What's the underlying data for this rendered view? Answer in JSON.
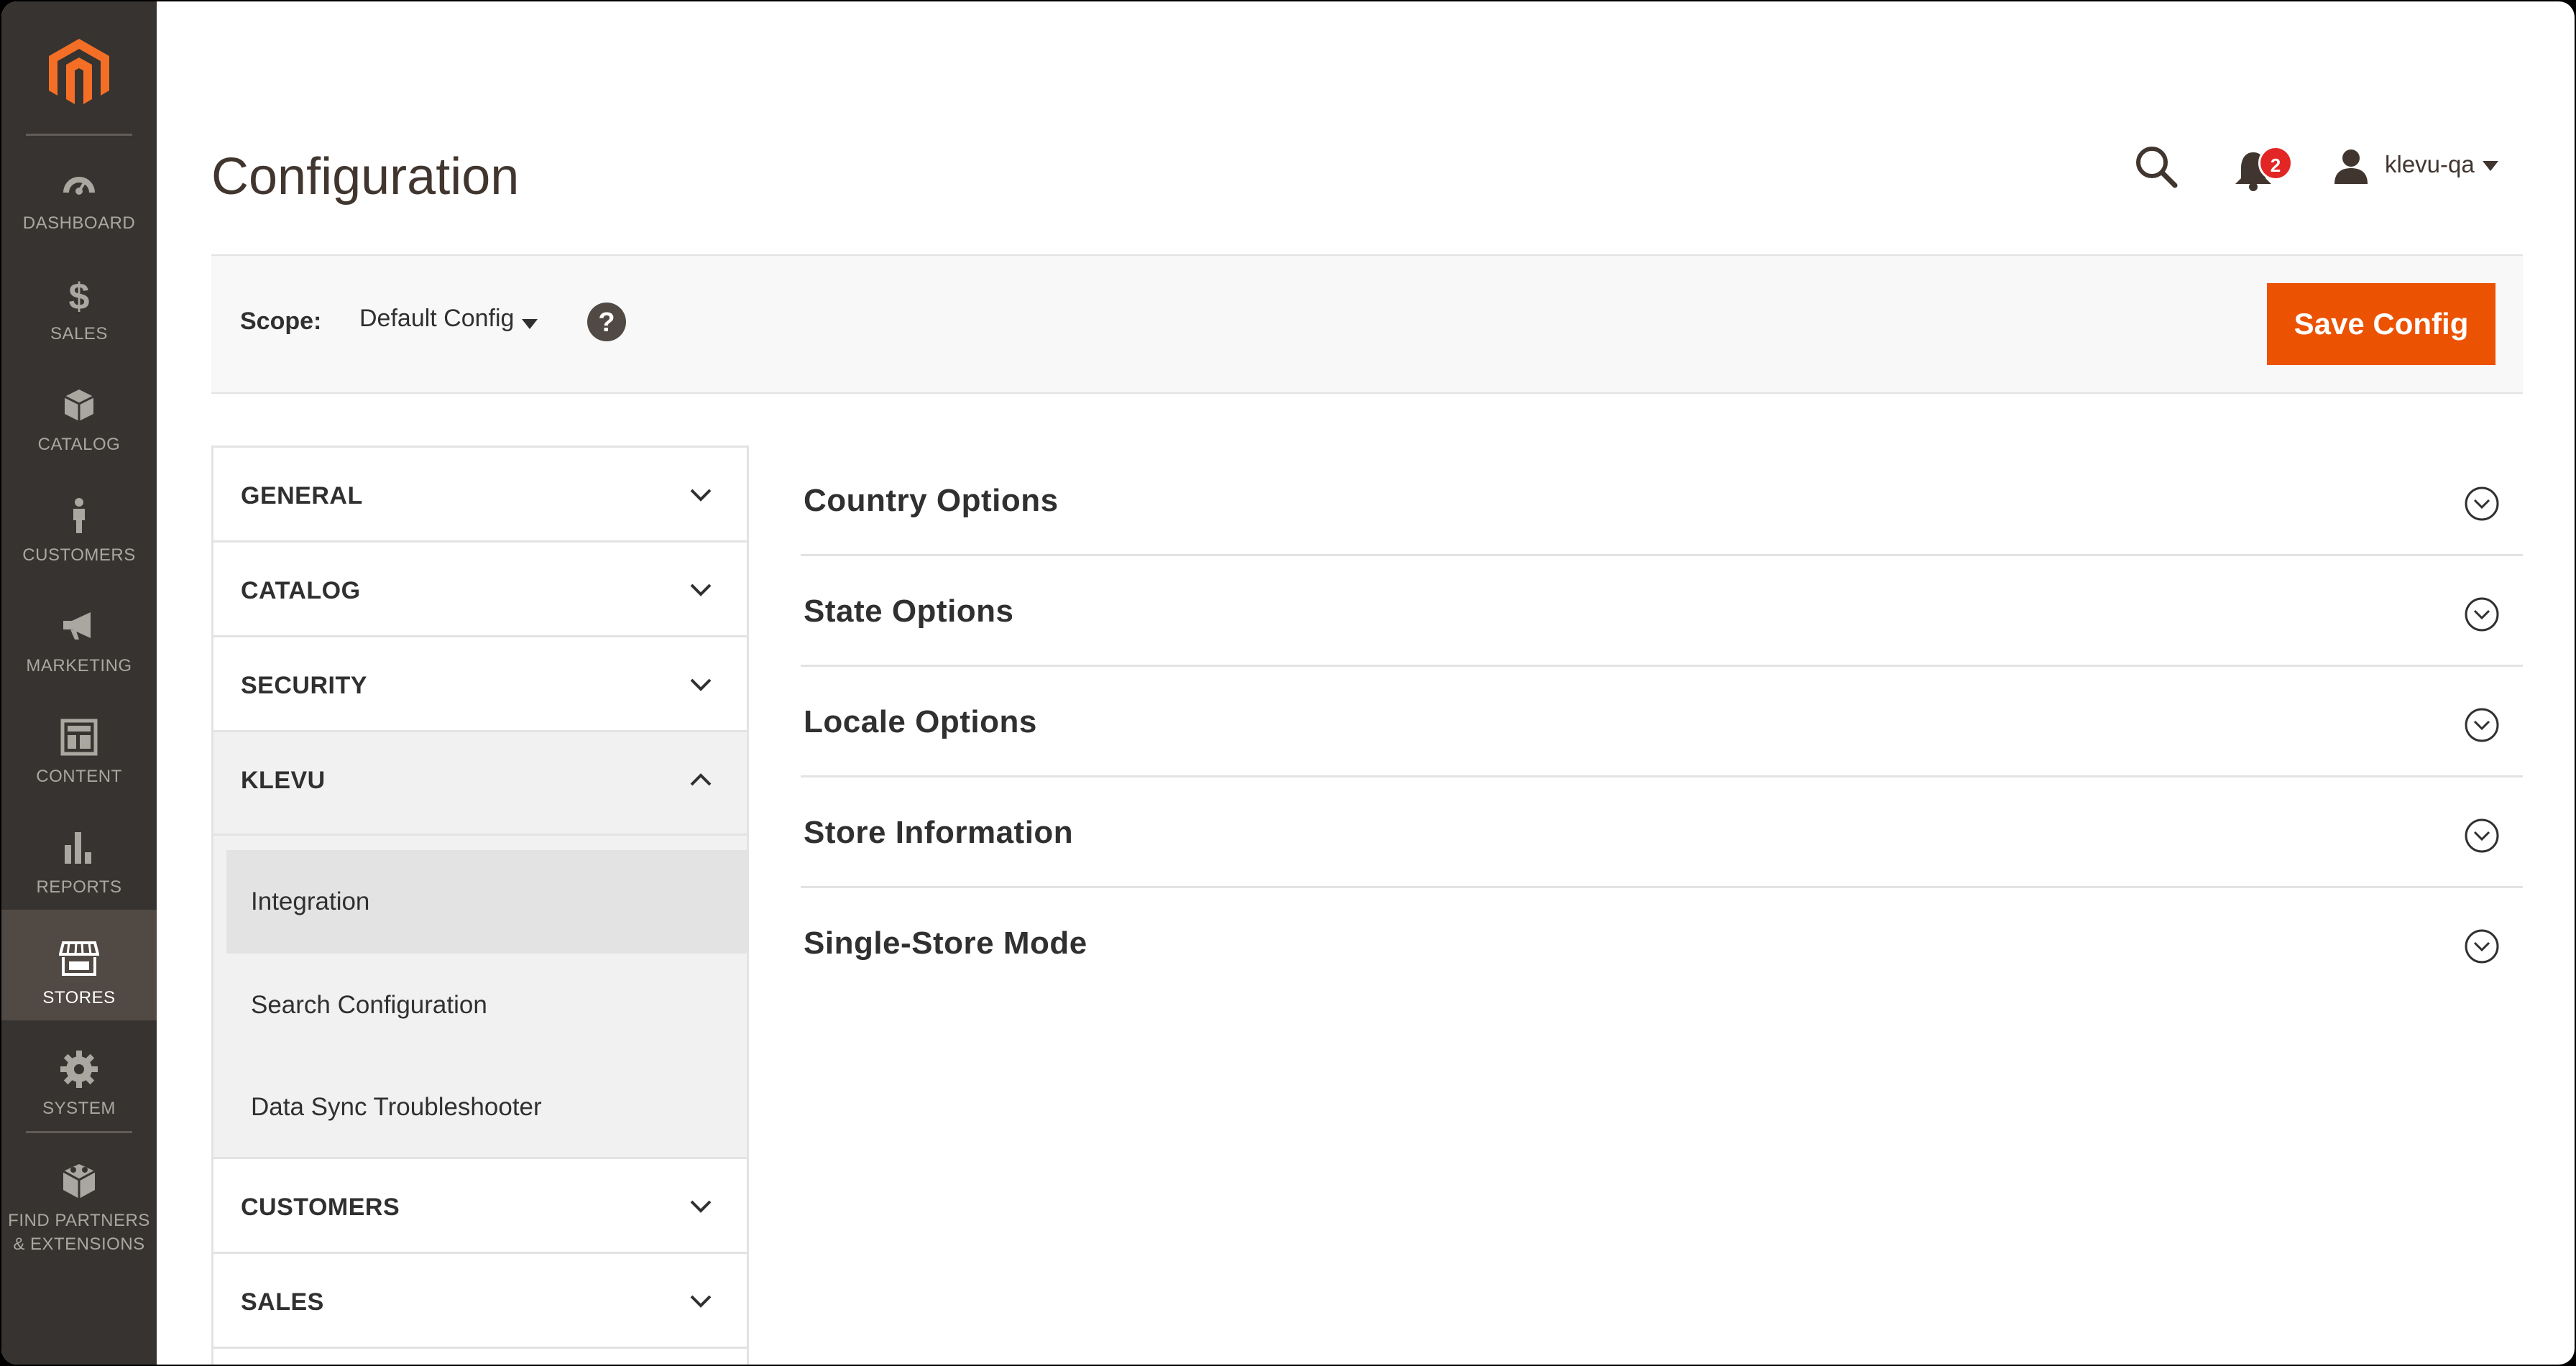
{
  "nav": {
    "items": [
      {
        "label": "DASHBOARD",
        "icon": "dashboard-icon",
        "active": false
      },
      {
        "label": "SALES",
        "icon": "dollar-icon",
        "active": false
      },
      {
        "label": "CATALOG",
        "icon": "box-icon",
        "active": false
      },
      {
        "label": "CUSTOMERS",
        "icon": "person-icon",
        "active": false
      },
      {
        "label": "MARKETING",
        "icon": "megaphone-icon",
        "active": false
      },
      {
        "label": "CONTENT",
        "icon": "layout-icon",
        "active": false
      },
      {
        "label": "REPORTS",
        "icon": "bar-chart-icon",
        "active": false
      },
      {
        "label": "STORES",
        "icon": "storefront-icon",
        "active": true
      },
      {
        "label": "SYSTEM",
        "icon": "gear-icon",
        "active": false
      },
      {
        "label": "FIND PARTNERS & EXTENSIONS",
        "icon": "extension-box-icon",
        "active": false
      }
    ]
  },
  "header": {
    "title": "Configuration",
    "notifications_count": "2",
    "user_name": "klevu-qa"
  },
  "scope": {
    "label": "Scope:",
    "selected": "Default Config",
    "save_label": "Save Config"
  },
  "tabs": [
    {
      "label": "GENERAL",
      "open": false
    },
    {
      "label": "CATALOG",
      "open": false
    },
    {
      "label": "SECURITY",
      "open": false
    },
    {
      "label": "KLEVU",
      "open": true
    },
    {
      "label": "CUSTOMERS",
      "open": false
    },
    {
      "label": "SALES",
      "open": false
    }
  ],
  "klevu_submenu": [
    {
      "label": "Integration",
      "active": true
    },
    {
      "label": "Search Configuration",
      "active": false
    },
    {
      "label": "Data Sync Troubleshooter",
      "active": false
    }
  ],
  "sections": [
    {
      "label": "Country Options"
    },
    {
      "label": "State Options"
    },
    {
      "label": "Locale Options"
    },
    {
      "label": "Store Information"
    },
    {
      "label": "Single-Store Mode"
    }
  ],
  "colors": {
    "nav_bg": "#373330",
    "nav_active_bg": "#514943",
    "accent": "#eb5202",
    "brand_logo": "#f46f25",
    "badge": "#e22626"
  }
}
